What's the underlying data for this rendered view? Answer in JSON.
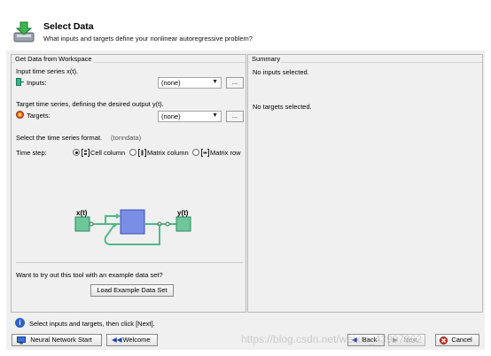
{
  "header": {
    "title": "Select Data",
    "subtitle": "What inputs and targets define your nonlinear autoregressive problem?"
  },
  "left_panel": {
    "title": "Get Data from Workspace",
    "inputs_caption": "Input time series x(t).",
    "inputs_label": "Inputs:",
    "inputs_value": "(none)",
    "targets_caption": "Target time series, defining the desired output y(t).",
    "targets_label": "Targets:",
    "targets_value": "(none)",
    "browse_label": "...",
    "format_caption": "Select the time series format.",
    "format_hint": "(tonndata)",
    "timestep_label": "Time step:",
    "timestep_options": [
      "Cell column",
      "Matrix column",
      "Matrix row"
    ],
    "timestep_selected": "Cell column",
    "diagram": {
      "input_label": "x(t)",
      "output_label": "y(t)"
    },
    "example_caption": "Want to try out this tool with an example data set?",
    "example_button": "Load Example Data Set"
  },
  "summary_panel": {
    "title": "Summary",
    "inputs_status": "No inputs selected.",
    "targets_status": "No targets selected."
  },
  "status": {
    "icon": "info-icon",
    "message": "Select inputs and targets, then click [Next]."
  },
  "footer": {
    "nn_start": "Neural Network Start",
    "welcome": "Welcome",
    "back": "Back",
    "next": "Next",
    "cancel": "Cancel"
  },
  "watermark": "https://blog.csdn.net/weixin_43997362",
  "colors": {
    "diagram_block": "#7a8ee6",
    "diagram_io": "#6cc79b",
    "diagram_line": "#4fb98a",
    "info_blue": "#2a62c9"
  }
}
